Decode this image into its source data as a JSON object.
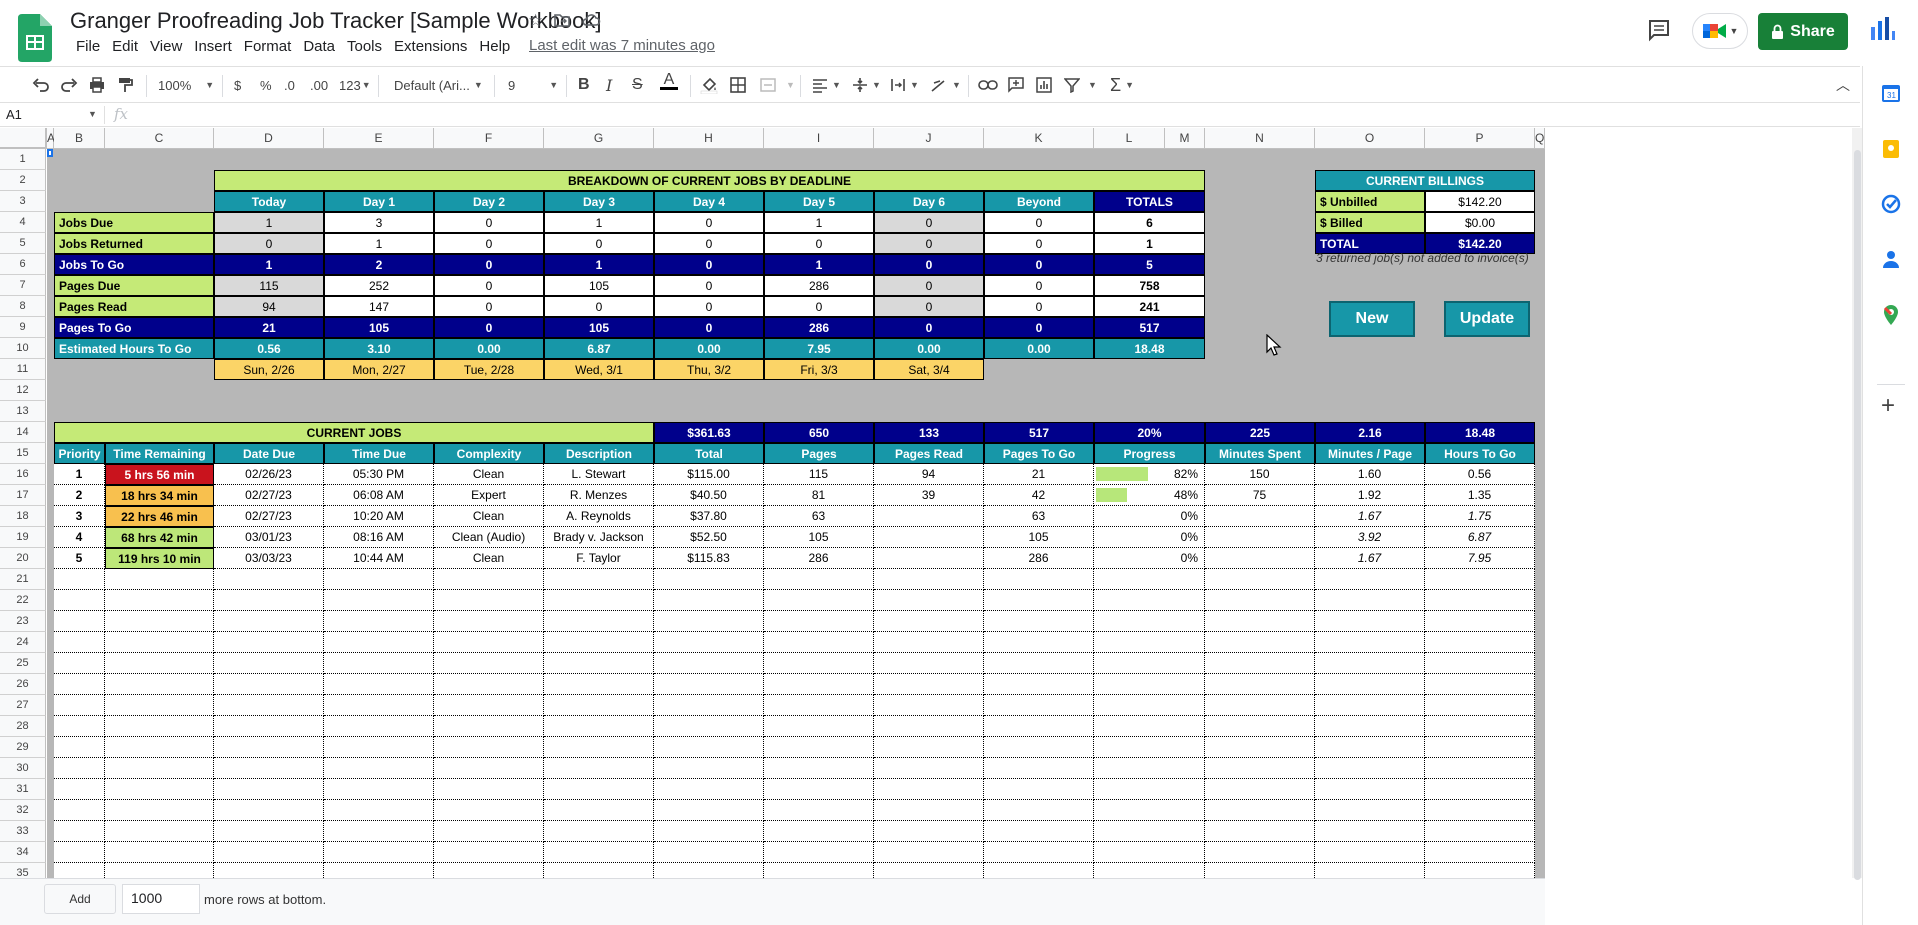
{
  "doc": {
    "title": "Granger Proofreading Job Tracker [Sample Workbook]",
    "last_edit": "Last edit was 7 minutes ago"
  },
  "menu": [
    "File",
    "Edit",
    "View",
    "Insert",
    "Format",
    "Data",
    "Tools",
    "Extensions",
    "Help"
  ],
  "header": {
    "share_label": "Share"
  },
  "toolbar": {
    "zoom": "100%",
    "currency": "$",
    "percent": "%",
    "dec_less": ".0",
    "dec_more": ".00",
    "more_formats": "123",
    "font": "Default (Ari...",
    "font_size": "9"
  },
  "formula": {
    "cell_ref": "A1",
    "fx": "fx"
  },
  "columns": [
    "A",
    "B",
    "C",
    "D",
    "E",
    "F",
    "G",
    "H",
    "I",
    "J",
    "K",
    "L",
    "M",
    "N",
    "O",
    "P",
    "Q"
  ],
  "rows": [
    "1",
    "2",
    "3",
    "4",
    "5",
    "6",
    "7",
    "8",
    "9",
    "10",
    "11",
    "12",
    "13",
    "14",
    "15",
    "16",
    "17",
    "18",
    "19",
    "20",
    "21",
    "22",
    "23",
    "24",
    "25",
    "26",
    "27",
    "28",
    "29",
    "30",
    "31",
    "32",
    "33",
    "34",
    "35"
  ],
  "breakdown": {
    "title": "BREAKDOWN OF CURRENT JOBS BY DEADLINE",
    "headers": [
      "Today",
      "Day 1",
      "Day 2",
      "Day 3",
      "Day 4",
      "Day 5",
      "Day 6",
      "Beyond",
      "TOTALS"
    ],
    "rows": [
      {
        "label": "Jobs Due",
        "values": [
          "1",
          "3",
          "0",
          "1",
          "0",
          "1",
          "0",
          "0",
          "6"
        ]
      },
      {
        "label": "Jobs Returned",
        "values": [
          "0",
          "1",
          "0",
          "0",
          "0",
          "0",
          "0",
          "0",
          "1"
        ]
      },
      {
        "label": "Jobs To Go",
        "values": [
          "1",
          "2",
          "0",
          "1",
          "0",
          "1",
          "0",
          "0",
          "5"
        ]
      },
      {
        "label": "Pages Due",
        "values": [
          "115",
          "252",
          "0",
          "105",
          "0",
          "286",
          "0",
          "0",
          "758"
        ]
      },
      {
        "label": "Pages Read",
        "values": [
          "94",
          "147",
          "0",
          "0",
          "0",
          "0",
          "0",
          "0",
          "241"
        ]
      },
      {
        "label": "Pages To Go",
        "values": [
          "21",
          "105",
          "0",
          "105",
          "0",
          "286",
          "0",
          "0",
          "517"
        ]
      },
      {
        "label": "Estimated Hours To Go",
        "values": [
          "0.56",
          "3.10",
          "0.00",
          "6.87",
          "0.00",
          "7.95",
          "0.00",
          "0.00",
          "18.48"
        ]
      }
    ],
    "dates": [
      "Sun, 2/26",
      "Mon, 2/27",
      "Tue, 2/28",
      "Wed, 3/1",
      "Thu, 3/2",
      "Fri, 3/3",
      "Sat, 3/4"
    ]
  },
  "billings": {
    "title": "CURRENT BILLINGS",
    "unbilled_label": "$ Unbilled",
    "unbilled_value": "$142.20",
    "billed_label": "$ Billed",
    "billed_value": "$0.00",
    "total_label": "TOTAL",
    "total_value": "$142.20",
    "note": "3 returned job(s) not added to invoice(s)"
  },
  "buttons": {
    "new": "New",
    "update": "Update"
  },
  "jobs": {
    "title": "CURRENT JOBS",
    "summary": [
      "$361.63",
      "650",
      "133",
      "517",
      "20%",
      "225",
      "2.16",
      "18.48"
    ],
    "headers": [
      "Priority",
      "Time Remaining",
      "Date Due",
      "Time Due",
      "Complexity",
      "Description",
      "Total",
      "Pages",
      "Pages Read",
      "Pages To Go",
      "Progress",
      "Minutes Spent",
      "Minutes / Page",
      "Hours To Go"
    ],
    "rows": [
      {
        "priority": "1",
        "remaining": "5 hrs 56 min",
        "date": "02/26/23",
        "time": "05:30 PM",
        "complexity": "Clean",
        "desc": "L. Stewart",
        "total": "$115.00",
        "pages": "115",
        "read": "94",
        "togo": "21",
        "progress": 0.82,
        "progress_label": "82%",
        "minutes": "150",
        "mpp": "1.60",
        "hours": "0.56",
        "level": "red",
        "est": false
      },
      {
        "priority": "2",
        "remaining": "18 hrs 34 min",
        "date": "02/27/23",
        "time": "06:08 AM",
        "complexity": "Expert",
        "desc": "R. Menzes",
        "total": "$40.50",
        "pages": "81",
        "read": "39",
        "togo": "42",
        "progress": 0.48,
        "progress_label": "48%",
        "minutes": "75",
        "mpp": "1.92",
        "hours": "1.35",
        "level": "orange",
        "est": false
      },
      {
        "priority": "3",
        "remaining": "22 hrs 46 min",
        "date": "02/27/23",
        "time": "10:20 AM",
        "complexity": "Clean",
        "desc": "A. Reynolds",
        "total": "$37.80",
        "pages": "63",
        "read": "",
        "togo": "63",
        "progress": 0,
        "progress_label": "0%",
        "minutes": "",
        "mpp": "1.67",
        "hours": "1.75",
        "level": "orange",
        "est": true
      },
      {
        "priority": "4",
        "remaining": "68 hrs 42 min",
        "date": "03/01/23",
        "time": "08:16 AM",
        "complexity": "Clean (Audio)",
        "desc": "Brady v. Jackson",
        "total": "$52.50",
        "pages": "105",
        "read": "",
        "togo": "105",
        "progress": 0,
        "progress_label": "0%",
        "minutes": "",
        "mpp": "3.92",
        "hours": "6.87",
        "level": "green",
        "est": true
      },
      {
        "priority": "5",
        "remaining": "119 hrs 10 min",
        "date": "03/03/23",
        "time": "10:44 AM",
        "complexity": "Clean",
        "desc": "F. Taylor",
        "total": "$115.83",
        "pages": "286",
        "read": "",
        "togo": "286",
        "progress": 0,
        "progress_label": "0%",
        "minutes": "",
        "mpp": "1.67",
        "hours": "7.95",
        "level": "green",
        "est": true
      }
    ]
  },
  "bottom": {
    "add_label": "Add",
    "rows_value": "1000",
    "more_text": "more rows at bottom."
  },
  "colors": {
    "dark_blue": "#00008b",
    "teal": "#1797a8",
    "light_green": "#c5ea77",
    "orange_date": "#fbd467",
    "urgent_red": "#c9131d",
    "progress_green": "#b7e77a"
  }
}
